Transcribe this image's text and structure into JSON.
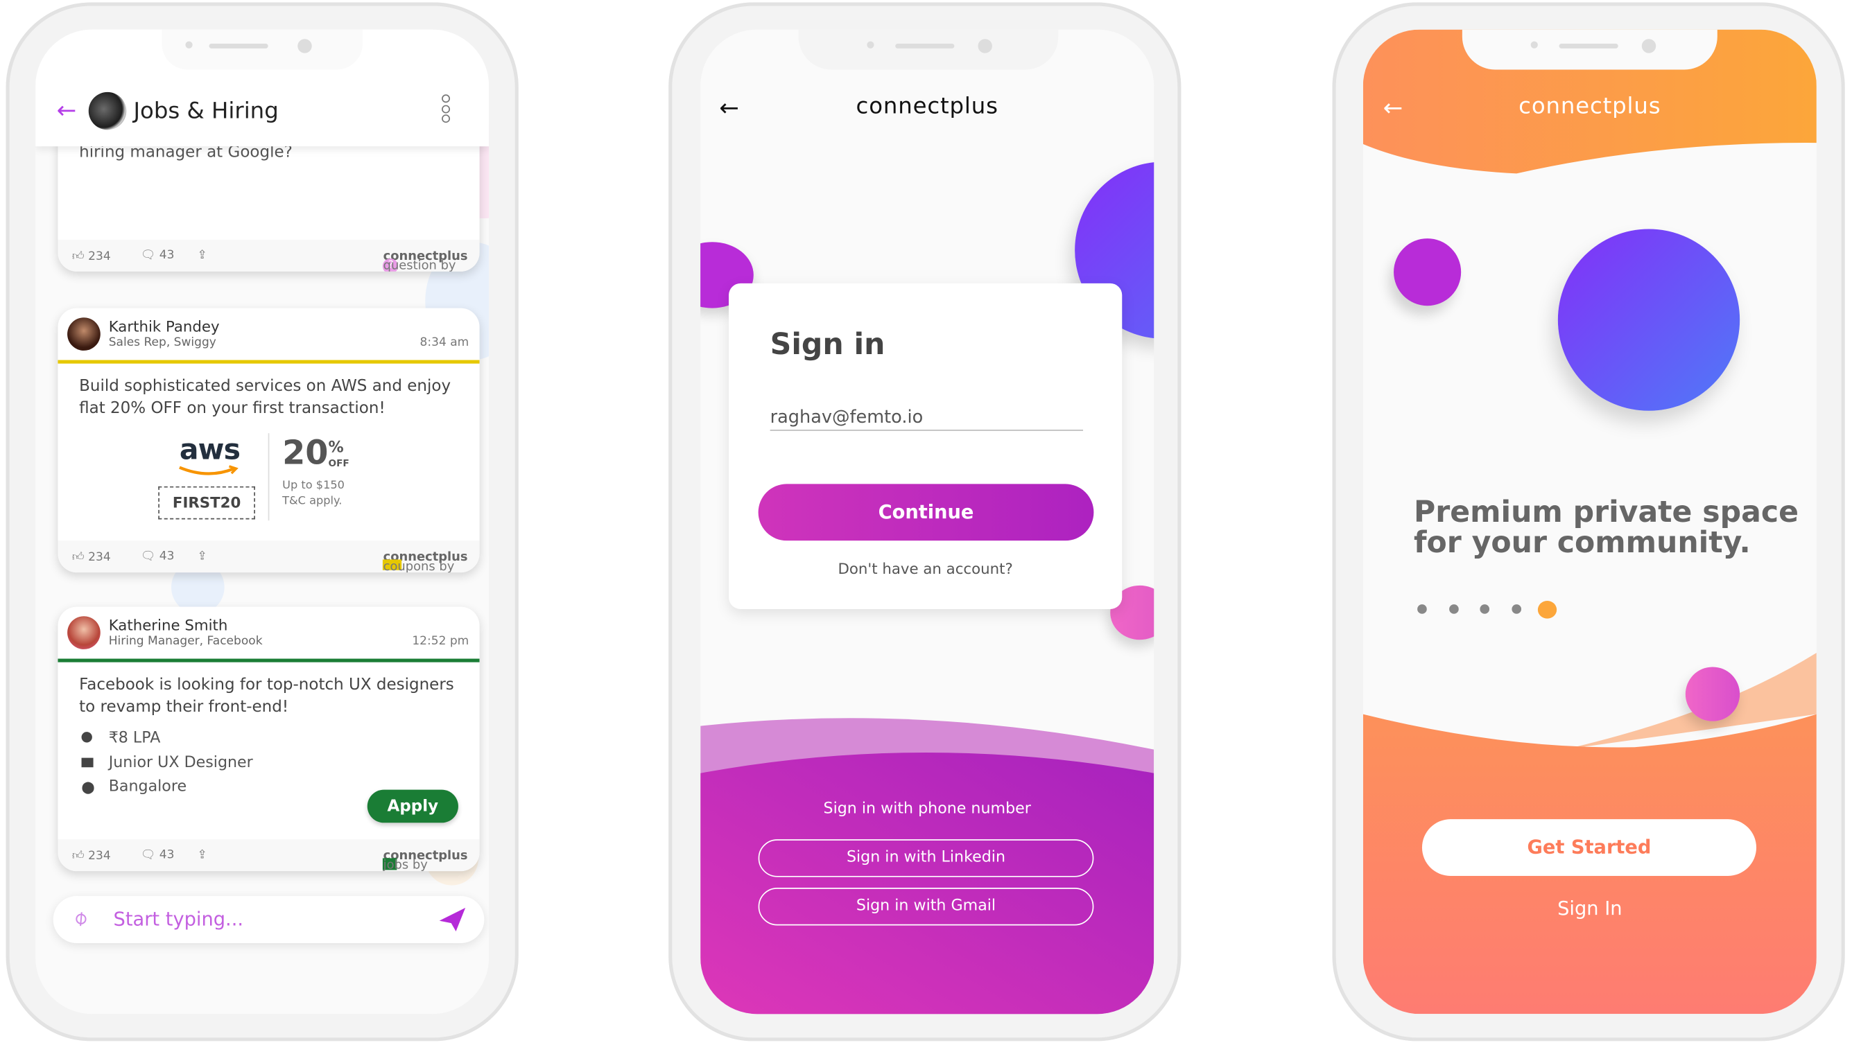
{
  "jobs_screen": {
    "header": {
      "title": "Jobs & Hiring",
      "back_icon": "arrow-left-icon",
      "menu_icon": "more-vertical-icon"
    },
    "posts": [
      {
        "text": "hiring manager at Google?",
        "likes": "234",
        "comments": "43",
        "source_prefix": "question by",
        "source_brand": "connectplus",
        "source_icon": "question-circle-icon"
      },
      {
        "author": "Karthik Pandey",
        "role": "Sales Rep, Swiggy",
        "time": "8:34 am",
        "accent": "#e6c800",
        "text": "Build sophisticated services on AWS and enjoy flat 20% OFF on your first transaction!",
        "coupon": {
          "brand": "aws",
          "code": "FIRST20",
          "discount": "20",
          "percent": "%",
          "off": "OFF",
          "limit": "Up to $150",
          "terms": "T&C apply."
        },
        "likes": "234",
        "comments": "43",
        "source_prefix": "coupons by",
        "source_brand": "connectplus",
        "source_icon": "ticket-icon"
      },
      {
        "author": "Katherine Smith",
        "role": "Hiring Manager, Facebook",
        "time": "12:52 pm",
        "accent": "#1a7d35",
        "text": "Facebook is looking for top-notch UX designers to revamp their front-end!",
        "details": [
          {
            "icon": "money-icon",
            "text": "₹8 LPA"
          },
          {
            "icon": "briefcase-icon",
            "text": "Junior UX Designer"
          },
          {
            "icon": "location-pin-icon",
            "text": "Bangalore"
          }
        ],
        "apply_label": "Apply",
        "likes": "234",
        "comments": "43",
        "source_prefix": "jobs by",
        "source_brand": "connectplus",
        "source_icon": "briefcase-icon"
      }
    ],
    "composer": {
      "placeholder": "Start typing...",
      "attach_icon": "paperclip-icon",
      "send_icon": "send-icon"
    }
  },
  "signin_screen": {
    "app_name": "connectplus",
    "title": "Sign in",
    "email_value": "raghav@femto.io",
    "continue_label": "Continue",
    "signup_prompt": "Don't have an account?",
    "phone_label": "Sign in with phone number",
    "linkedin_label": "Sign in with Linkedin",
    "gmail_label": "Sign in with Gmail",
    "accent": "#c02ec4"
  },
  "onboarding_screen": {
    "app_name": "connectplus",
    "headline_line1": "Premium private space",
    "headline_line2": "for your community.",
    "pager": {
      "total": 5,
      "active": 5
    },
    "get_started_label": "Get Started",
    "sign_in_label": "Sign In",
    "accent": "#fca63a"
  }
}
